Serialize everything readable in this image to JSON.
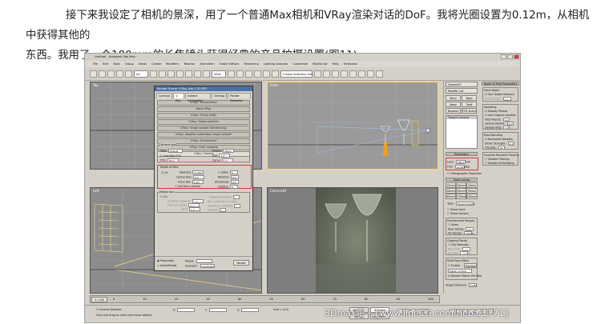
{
  "article": {
    "line1": "接下来我设定了相机的景深，用了一个普通Max相机和VRay渲染对话的DoF。我将光圈设置为0.12m，从相机中获得其他的",
    "line2": "东西。我用了一个180mm的长焦镜头获得经典的产品拍摄设置(图11)。"
  },
  "app": {
    "title": "Untitled - Autodesk 3ds Max",
    "menu": [
      "File",
      "Edit",
      "Tools",
      "Group",
      "Views",
      "Create",
      "Modifiers",
      "Reactor",
      "Animation",
      "Graph Editors",
      "Rendering",
      "Lighting Analysis",
      "Customize",
      "MAXScript",
      "Help",
      "Tentacles"
    ],
    "toolbar_field_view": "View",
    "toolbar_field_selection": "Create Selection Set",
    "viewports": {
      "top": "Top",
      "front": "Front",
      "left": "Left",
      "persp": "Camera01"
    }
  },
  "dialog": {
    "title": "Render Scene: V-Ray Adv 1.50.SP2",
    "tabs": [
      "Common",
      "V-Ray",
      "Indirect illumination",
      "Settings",
      "Render Elements"
    ],
    "rollouts": [
      "V-Ray:: Authorization",
      "About VRay",
      "V-Ray:: Frame buffer",
      "V-Ray:: Global switches",
      "V-Ray:: Image sampler (Antialiasing)",
      "V-Ray:: Adaptive subdivision image sampler",
      "V-Ray:: Environment",
      "V-Ray:: Color mapping",
      "V-Ray:: Camera"
    ],
    "camera_type": {
      "group": "Camera type",
      "type_label": "Type",
      "type_value": "Default",
      "override_fov": "Override FOV",
      "fov_label": "FOV",
      "fov_value": "45.0",
      "height_label": "Height",
      "height_value": "400.0",
      "dist_label": "Dist",
      "dist_value": "2.0",
      "curve_label": "Curve",
      "curve_value": "1.0"
    },
    "dof": {
      "group": "Depth of field",
      "on_label": "On",
      "aperture_label": "Aperture",
      "aperture_value": "0.12m",
      "center_bias_label": "Center bias",
      "center_bias_value": "0.0",
      "focal_dist_label": "Focal dist",
      "focal_dist_value": "0.2m",
      "get_from_camera": "Get from camera",
      "sides_label": "Sides",
      "sides_value": "5",
      "rotation_label": "Rotation",
      "rotation_value": "0.0",
      "anisotropy_label": "Anisotropy",
      "anisotropy_value": "0.0",
      "subdivs_label": "Subdivs",
      "subdivs_value": "8"
    },
    "motion_blur": {
      "group": "Motion blur",
      "on_label": "On",
      "duration_label": "Duration (frames)",
      "duration_value": "1.0",
      "interval_label": "Interval center",
      "interval_value": "0.5",
      "bias_label": "Bias",
      "bias_value": "0.0",
      "subdivs_label": "Subdivs",
      "subdivs_value": "6",
      "prepass_label": "Prepass samples",
      "prepass_value": "1",
      "blur_particles_label": "Blur particles as mesh",
      "geometry_label": "Geometry samples",
      "geometry_value": "2"
    },
    "footer": {
      "mode": "Production",
      "activeshade": "ActiveShade",
      "preset_label": "Preset:",
      "preset_value": "---------------",
      "viewport_label": "Viewport:",
      "viewport_value": "Camera01",
      "render_button": "Render"
    }
  },
  "command_panel": {
    "object_name": "Camera01",
    "modifier_list": "Modifier List",
    "buttons": [
      "Bend",
      "Taper",
      "Noise",
      "Twist",
      "Displace",
      "FFD 4x4x4"
    ],
    "stack_item": "Target Camera",
    "parameters_header": "Parameters",
    "lens_label": "Lens:",
    "lens_value": "180.0",
    "lens_unit": "mm",
    "fov_label": "FOV:",
    "fov_value": "11.421",
    "fov_unit": "deg.",
    "ortho_label": "Orthographic Projection",
    "stock_lenses": "Stock Lenses",
    "stock": [
      "15mm",
      "20mm",
      "24mm",
      "28mm",
      "35mm",
      "50mm",
      "85mm",
      "135mm",
      "200mm"
    ],
    "type_label": "Type:",
    "type_value": "Target Camera",
    "show_cone": "Show Cone",
    "show_horizon": "Show Horizon",
    "env_ranges": "Environment Ranges",
    "show_env": "Show",
    "near_range_label": "Near Range:",
    "near_range_value": "0.0",
    "far_range_label": "Far Range:",
    "far_range_value": "1000.0",
    "clipping": "Clipping Planes",
    "clip_manually": "Clip Manually",
    "near_clip_label": "Near Clip:",
    "near_clip_value": "1.0",
    "far_clip_label": "Far Clip:",
    "far_clip_value": "1000.0",
    "multipass": "Multi-Pass Effect",
    "enable": "Enable",
    "preview": "Preview",
    "effect_value": "Depth of Field",
    "render_effects": "Render Effects Per Pass",
    "target_distance_label": "Target Distance:",
    "target_distance_value": "0.285"
  },
  "params_panel": {
    "header": "Depth of Field Parameters",
    "focal_depth": "Focal Depth",
    "use_target": "Use Target Distance",
    "focal_depth_label": "Focal Depth:",
    "focal_depth_value": "0.3",
    "sampling": "Sampling",
    "display_passes": "Display Passes",
    "use_original": "Use Original Location",
    "total_passes_label": "Total Passes:",
    "total_passes_value": "12",
    "sample_radius_label": "Sample Radius:",
    "sample_radius_value": "1.0",
    "sample_bias_label": "Sample Bias:",
    "sample_bias_value": "0.5",
    "pass_blending": "Pass Blending",
    "normalize": "Normalize Weights",
    "dither_label": "Dither Strength:",
    "dither_value": "0.4",
    "tile_label": "Tile Size:",
    "tile_value": "32",
    "scanline": "Scanline Renderer Params",
    "disable_filtering": "Disable Filtering",
    "disable_aa": "Disable Antialiasing"
  },
  "timeline": {
    "frame": "0 / 100",
    "ticks": [
      "0",
      "10",
      "20",
      "30",
      "40",
      "50",
      "60",
      "70",
      "80",
      "90",
      "100"
    ]
  },
  "status": {
    "selected": "1 Camera Selected",
    "hint": "Click and drag to select and move objects",
    "x_label": "X:",
    "y_label": "Y:",
    "z_label": "Z:",
    "grid": "Grid = 10.0",
    "auto_key": "Auto Key",
    "selected_btn": "Selected",
    "set_key": "Set Key",
    "key_filters": "Key Filters..."
  },
  "watermark": "3Dmax吧 - {www.lineCG.com/tieba/1771}"
}
